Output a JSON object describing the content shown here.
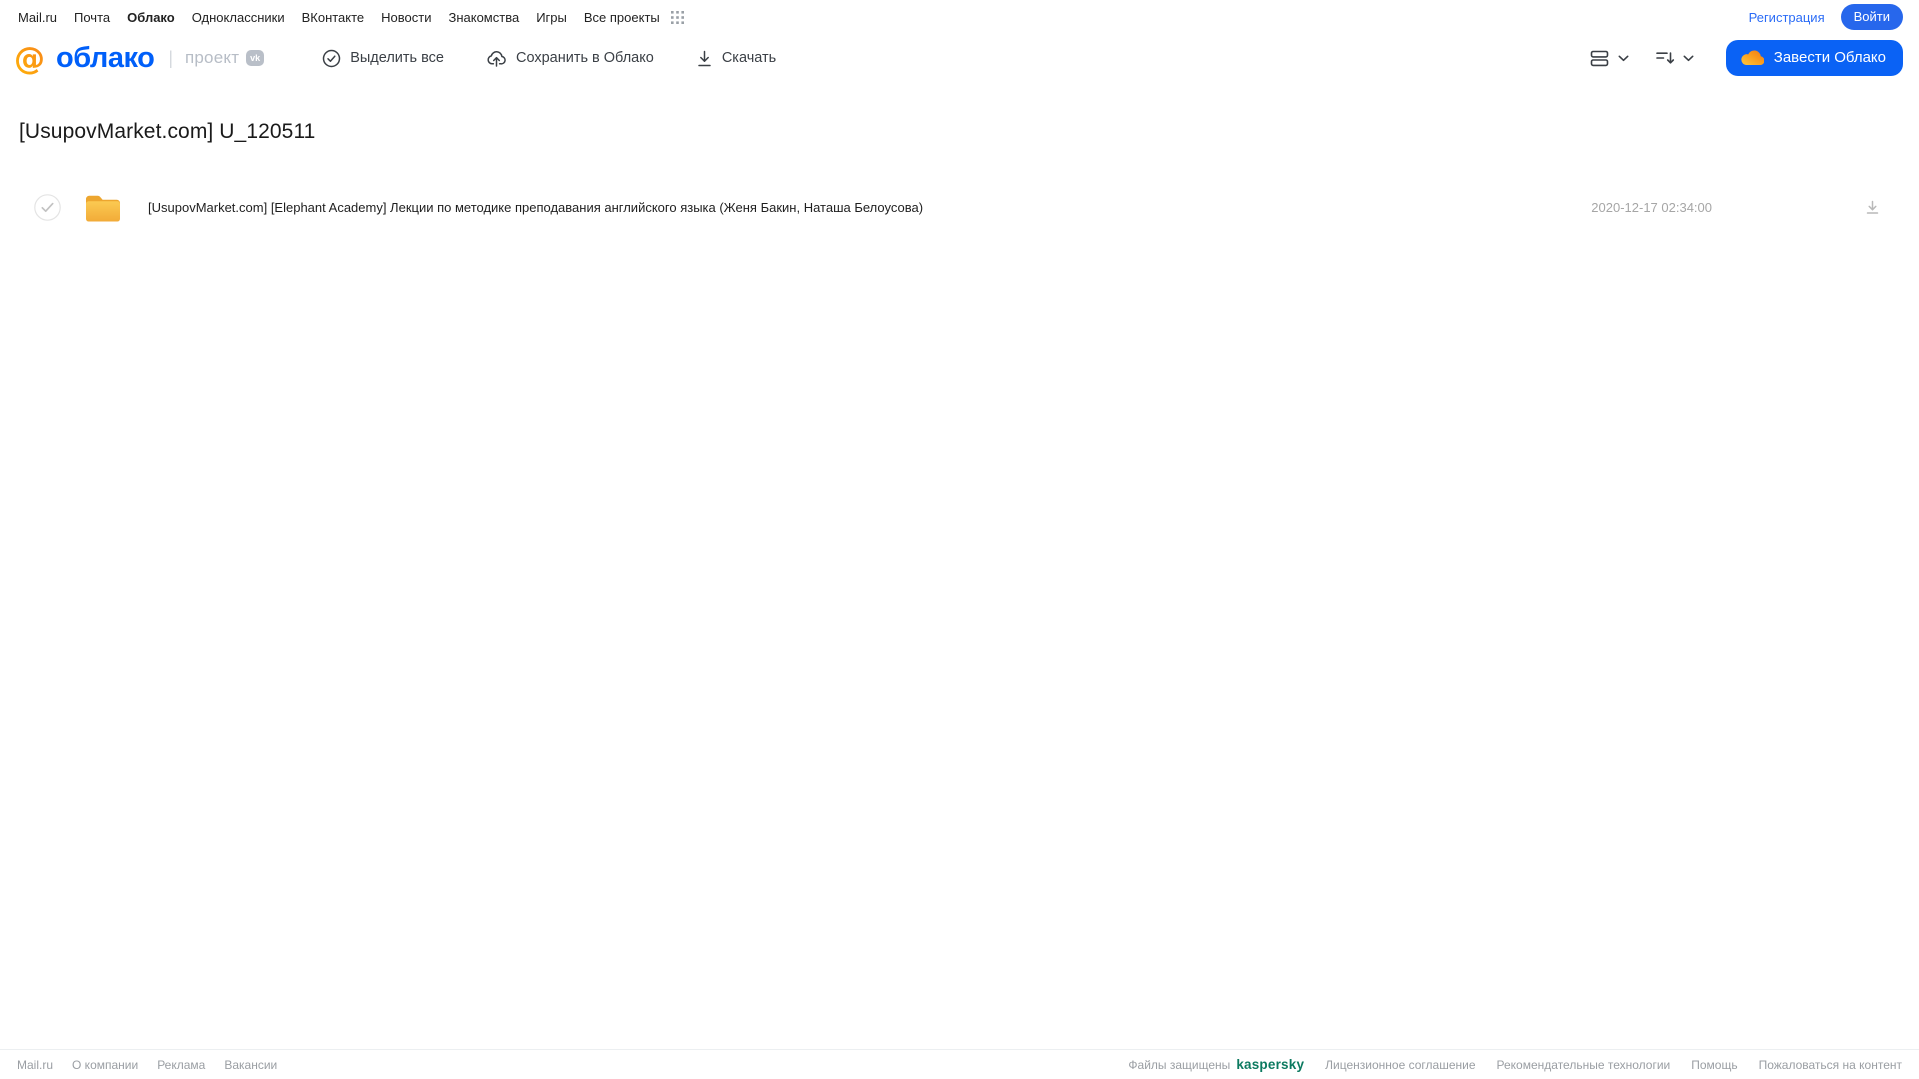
{
  "top_nav": {
    "links": [
      {
        "label": "Mail.ru",
        "active": false
      },
      {
        "label": "Почта",
        "active": false
      },
      {
        "label": "Облако",
        "active": true
      },
      {
        "label": "Одноклассники",
        "active": false
      },
      {
        "label": "ВКонтакте",
        "active": false
      },
      {
        "label": "Новости",
        "active": false
      },
      {
        "label": "Знакомства",
        "active": false
      },
      {
        "label": "Игры",
        "active": false
      },
      {
        "label": "Все проекты",
        "active": false
      }
    ],
    "apps_grid_icon": "apps-grid-icon",
    "register_label": "Регистрация",
    "login_label": "Войти"
  },
  "header": {
    "logo": {
      "at_symbol": "@",
      "text": "облако",
      "project_label": "проект",
      "project_badge": "vk"
    },
    "toolbar": {
      "select_all_label": "Выделить все",
      "save_to_cloud_label": "Сохранить в Облако",
      "download_label": "Скачать"
    },
    "view_control_icon": "list-view-icon",
    "sort_control_icon": "sort-icon",
    "create_cloud_label": "Завести Облако"
  },
  "content": {
    "title": "[UsupovMarket.com] U_120511",
    "files": [
      {
        "type": "folder",
        "name": "[UsupovMarket.com] [Elephant Academy]  Лекции по методике преподавания английского языка (Женя Бакин, Наташа Белоусова)",
        "date": "2020-12-17 02:34:00"
      }
    ]
  },
  "footer": {
    "left_links": [
      "Mail.ru",
      "О компании",
      "Реклама",
      "Вакансии"
    ],
    "protected_text": "Файлы защищены",
    "protected_brand": "kaspersky",
    "right_links": [
      "Лицензионное соглашение",
      "Рекомендательные технологии",
      "Помощь",
      "Пожаловаться на контент"
    ]
  },
  "icons": {
    "select_all": "check-circle-icon",
    "save_to_cloud": "cloud-upload-icon",
    "download": "download-icon",
    "view_mode": "list-view-icon",
    "sort": "sort-icon",
    "create_cloud": "cloud-icon",
    "file": "folder-icon",
    "row_action": "download-icon",
    "apps": "apps-grid-icon"
  },
  "colors": {
    "accent_blue": "#0a62f5",
    "logo_blue": "#005ff9",
    "logo_orange": "#ff9a00",
    "folder_yellow": "#f5bc44",
    "kaspersky_green": "#0c7a60",
    "muted_gray": "#a6a6a6"
  }
}
